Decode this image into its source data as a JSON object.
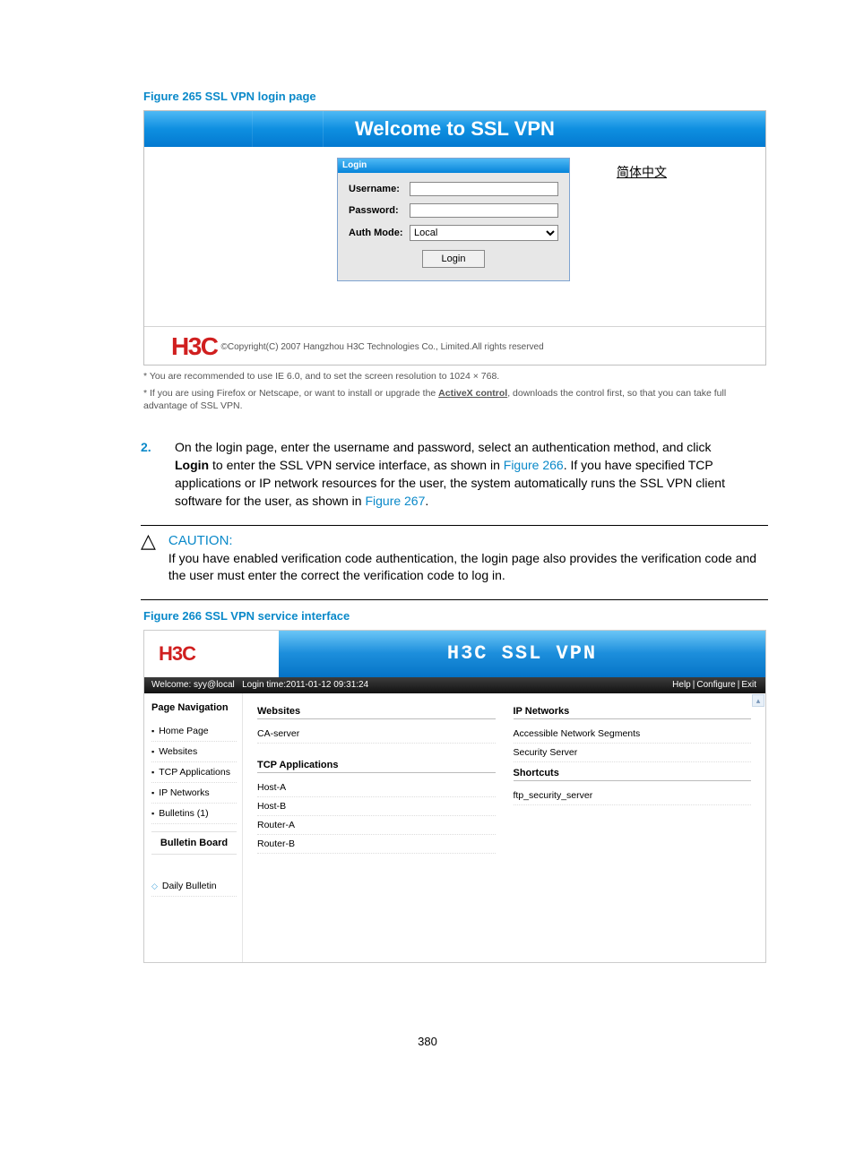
{
  "figure265": {
    "caption": "Figure 265 SSL VPN login page",
    "bannerTitle": "Welcome to SSL VPN",
    "langLink": "简体中文",
    "loginBoxTitle": "Login",
    "labels": {
      "username": "Username:",
      "password": "Password:",
      "authMode": "Auth Mode:"
    },
    "authModeValue": "Local",
    "loginButton": "Login",
    "logoText": "H3C",
    "copyright": "©Copyright(C) 2007 Hangzhou H3C Technologies Co., Limited.All rights reserved",
    "note1": "* You are recommended to use IE 6.0, and to set the screen resolution to 1024 × 768.",
    "note2a": "* If you are using Firefox or Netscape, or want to install or upgrade the ",
    "note2Link": "ActiveX control",
    "note2b": ", downloads the control first, so that you can take full advantage of SSL VPN."
  },
  "step2": {
    "num": "2.",
    "part1": "On the login page, enter the username and password, select an authentication method, and click ",
    "bold1": "Login",
    "part2": " to enter the SSL VPN service interface, as shown in ",
    "link1": "Figure 266",
    "part3": ". If you have specified TCP applications or IP network resources for the user, the system automatically runs the SSL VPN client software for the user, as shown in ",
    "link2": "Figure 267",
    "part4": "."
  },
  "caution": {
    "symbol": "△",
    "title": "CAUTION:",
    "text": "If you have enabled verification code authentication, the login page also provides the verification code and the user must enter the correct the verification code to log in."
  },
  "figure266": {
    "caption": "Figure 266 SSL VPN service interface",
    "logoText": "H3C",
    "appTitle": "H3C SSL VPN",
    "welcome": "Welcome: syy@local",
    "loginTime": "Login time:2011-01-12 09:31:24",
    "links": {
      "help": "Help",
      "configure": "Configure",
      "exit": "Exit"
    },
    "sep": " | ",
    "nav": {
      "title": "Page Navigation",
      "items": [
        "Home Page",
        "Websites",
        "TCP Applications",
        "IP Networks",
        "Bulletins (1)"
      ],
      "boardTitle": "Bulletin Board",
      "daily": "Daily Bulletin"
    },
    "leftCol": {
      "websitesTitle": "Websites",
      "websitesItems": [
        "CA-server"
      ],
      "tcpTitle": "TCP Applications",
      "tcpItems": [
        "Host-A",
        "Host-B",
        "Router-A",
        "Router-B"
      ]
    },
    "rightCol": {
      "ipTitle": "IP Networks",
      "ipItems": [
        "Accessible Network Segments",
        "Security Server"
      ],
      "shortcutsTitle": "Shortcuts",
      "shortcutsItems": [
        "ftp_security_server"
      ]
    }
  },
  "pageNumber": "380"
}
